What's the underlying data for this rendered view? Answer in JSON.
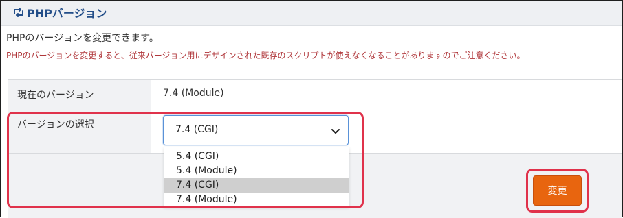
{
  "panel": {
    "title": "PHPバージョン",
    "icon": "refresh-icon"
  },
  "intro": "PHPのバージョンを変更できます。",
  "warning": "PHPのバージョンを変更すると、従来バージョン用にデザインされた既存のスクリプトが使えなくなることがありますのでご注意ください。",
  "current": {
    "label": "現在のバージョン",
    "value": "7.4 (Module)"
  },
  "selection": {
    "label": "バージョンの選択",
    "selected": "7.4 (CGI)",
    "options": [
      "5.4 (CGI)",
      "5.4 (Module)",
      "7.4 (CGI)",
      "7.4 (Module)"
    ]
  },
  "button": {
    "label": "変更"
  },
  "colors": {
    "title": "#234e89",
    "warning": "#b0373b",
    "button": "#e8650f",
    "highlight": "#e0324b",
    "selected_option": "#cfcfcf"
  }
}
